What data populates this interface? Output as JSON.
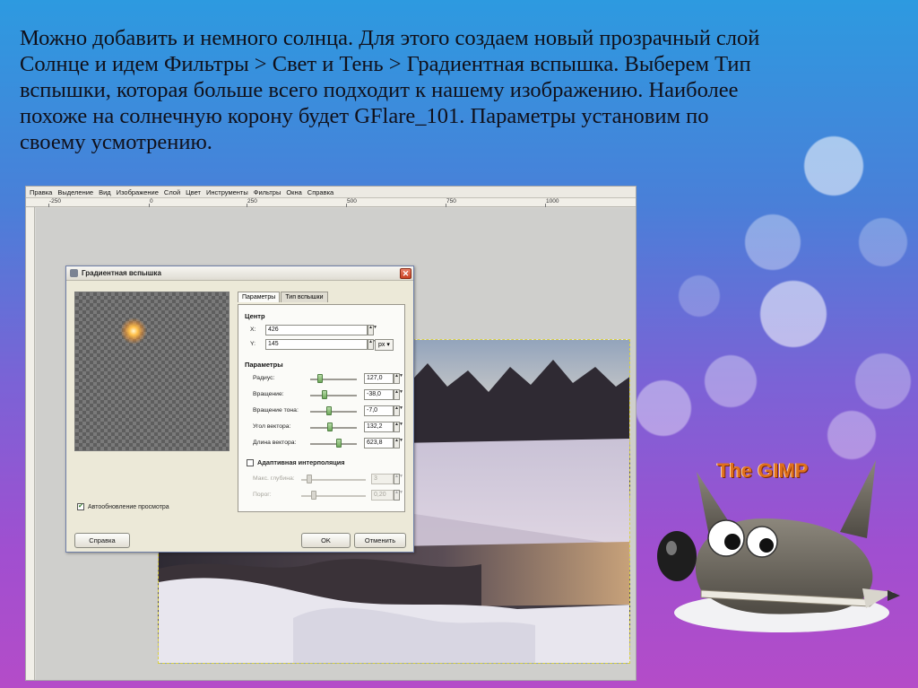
{
  "slide": {
    "lines": [
      "Можно добавить и немного солнца.  Для этого создаем новый прозрачный слой",
      "Солнце и идем Фильтры > Свет и Тень > Градиентная вспышка. Выберем Тип",
      "вспышки, которая больше всего подходит к нашему изображению.  Наиболее",
      "похоже на солнечную корону будет GFlare_101. Параметры  установим по",
      "своему усмотрению."
    ]
  },
  "menubar": {
    "items": [
      "Правка",
      "Выделение",
      "Вид",
      "Изображение",
      "Слой",
      "Цвет",
      "Инструменты",
      "Фильтры",
      "Окна",
      "Справка"
    ]
  },
  "ruler": {
    "labels": [
      "-250",
      "0",
      "250",
      "500",
      "750",
      "1000"
    ]
  },
  "dialog": {
    "title": "Градиентная вспышка",
    "close_label": "✕",
    "auto_preview_label": "Автообновление просмотра",
    "auto_preview_checked": true,
    "help_button": "Справка",
    "ok_button": "OK",
    "cancel_button": "Отменить",
    "tabs": [
      {
        "label": "Параметры",
        "active": true
      },
      {
        "label": "Тип вспышки",
        "active": false
      }
    ],
    "center": {
      "title": "Центр",
      "x_label": "X:",
      "x_value": "426",
      "y_label": "Y:",
      "y_value": "145",
      "unit": "px"
    },
    "params": {
      "title": "Параметры",
      "rows": [
        {
          "label": "Радиус:",
          "value": "127,0",
          "level": 0.22
        },
        {
          "label": "Вращение:",
          "value": "-38,0",
          "level": 0.3
        },
        {
          "label": "Вращение тона:",
          "value": "-7,0",
          "level": 0.4
        },
        {
          "label": "Угол вектора:",
          "value": "132,2",
          "level": 0.42
        },
        {
          "label": "Длина вектора:",
          "value": "623,8",
          "level": 0.62
        }
      ]
    },
    "adaptive": {
      "label": "Адаптивная интерполяция",
      "checked": false,
      "rows": [
        {
          "label": "Макс. глубина:",
          "value": "3",
          "level": 0.12
        },
        {
          "label": "Порог:",
          "value": "0,20",
          "level": 0.2
        }
      ]
    }
  },
  "mascot": {
    "title": "The GIMP"
  }
}
